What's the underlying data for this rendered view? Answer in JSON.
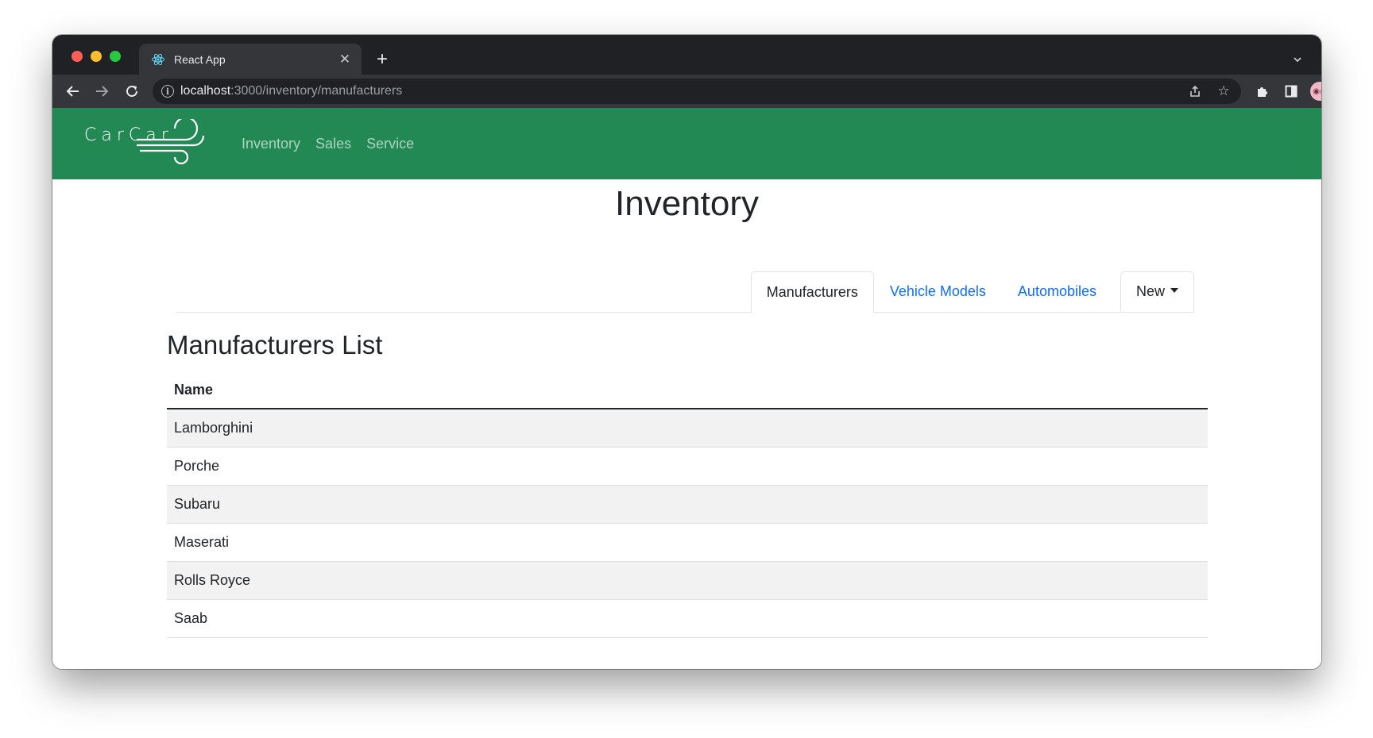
{
  "browser": {
    "tab_title": "React App",
    "url_host": "localhost",
    "url_path": ":3000/inventory/manufacturers",
    "icons": [
      "react-favicon-icon",
      "close-icon",
      "plus-icon",
      "chevron-down-icon",
      "back-arrow-icon",
      "forward-arrow-icon",
      "reload-icon",
      "info-icon",
      "share-icon",
      "star-icon",
      "puzzle-icon",
      "sidebar-icon",
      "avatar",
      "more-vert-icon"
    ]
  },
  "navbar": {
    "brand": "CarCar",
    "links": [
      "Inventory",
      "Sales",
      "Service"
    ],
    "background": "#238954"
  },
  "page": {
    "title": "Inventory",
    "tabs": [
      "Manufacturers",
      "Vehicle Models",
      "Automobiles"
    ],
    "active_tab": "Manufacturers",
    "dropdown_label": "New"
  },
  "list": {
    "title": "Manufacturers List",
    "column_header": "Name",
    "rows": [
      "Lamborghini",
      "Porche",
      "Subaru",
      "Maserati",
      "Rolls Royce",
      "Saab"
    ]
  },
  "colors": {
    "link": "#0d6efd",
    "stripe": "#f2f2f2"
  }
}
